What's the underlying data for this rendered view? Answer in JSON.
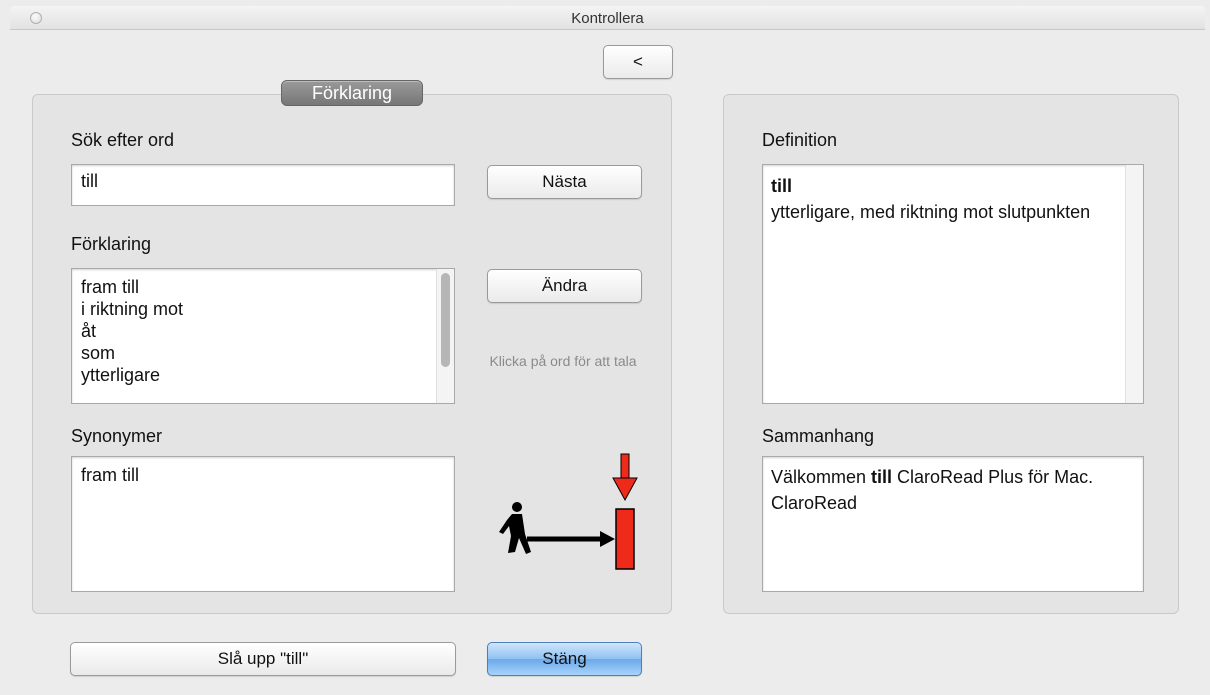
{
  "window": {
    "title": "Kontrollera"
  },
  "toolbar": {
    "back_label": "<"
  },
  "left_panel": {
    "tab_label": "Förklaring",
    "search_label": "Sök efter ord",
    "search_value": "till",
    "next_button": "Nästa",
    "explanation_label": "Förklaring",
    "explanation_items": [
      "fram till",
      "i riktning mot",
      "åt",
      "som",
      "ytterligare"
    ],
    "change_button": "Ändra",
    "hint": "Klicka på ord för att tala",
    "synonyms_label": "Synonymer",
    "synonyms": [
      "fram till"
    ],
    "illustration_icon": "person-walking-to-target-icon"
  },
  "right_panel": {
    "definition_label": "Definition",
    "definition_word": "till",
    "definition_text": "ytterligare, med riktning mot slutpunkten",
    "context_label": "Sammanhang",
    "context_before": "Välkommen ",
    "context_word": "till",
    "context_after": " ClaroRead Plus för Mac. ClaroRead"
  },
  "footer": {
    "lookup_button": "Slå upp \"till\"",
    "close_button": "Stäng"
  },
  "colors": {
    "accent_blue": "#8fc1f2",
    "arrow_red": "#ee2a1b"
  }
}
